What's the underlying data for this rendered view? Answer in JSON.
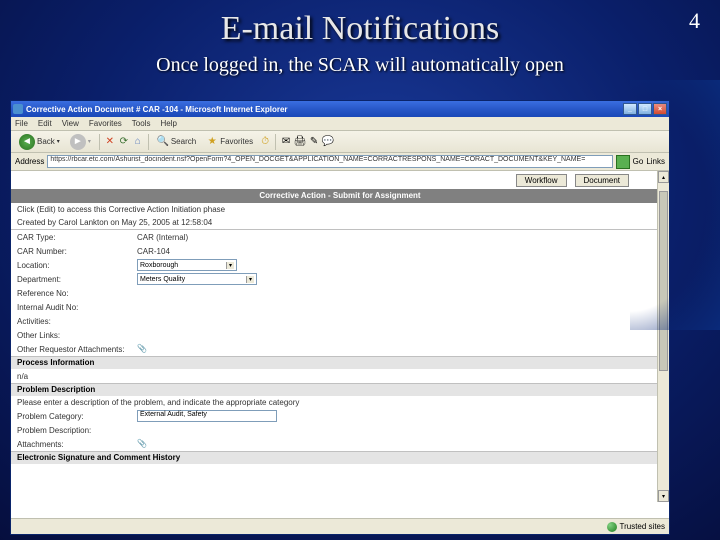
{
  "slide": {
    "title": "E-mail Notifications",
    "page_number": "4",
    "subtitle": "Once logged in, the SCAR will automatically open"
  },
  "window": {
    "title": "Corrective Action Document # CAR -104 - Microsoft Internet Explorer"
  },
  "menu": {
    "file": "File",
    "edit": "Edit",
    "view": "View",
    "favorites": "Favorites",
    "tools": "Tools",
    "help": "Help"
  },
  "toolbar": {
    "back": "Back",
    "search": "Search",
    "favorites": "Favorites"
  },
  "address": {
    "label": "Address",
    "url": "https://rbcar.etc.com/Ashurist_docindent.nsf?OpenForm?4_OPEN_DOCGET&APPLICATION_NAME=CORRACTRESPONS_NAME=CORACT_DOCUMENT&KEY_NAME=",
    "go": "Go",
    "links": "Links"
  },
  "actions": {
    "workflow": "Workflow",
    "document": "Document"
  },
  "banner": "Corrective Action - Submit for Assignment",
  "instructions": "Click (Edit) to access this Corrective Action Initiation phase",
  "created": "Created by Carol Lankton on May 25, 2005 at 12:58:04",
  "form": {
    "car_type_label": "CAR Type:",
    "car_type_value": "CAR (Internal)",
    "car_number_label": "CAR Number:",
    "car_number_value": "CAR-104",
    "location_label": "Location:",
    "location_value": "Roxborough",
    "department_label": "Department:",
    "department_value": "Meters Quality",
    "reference_label": "Reference No:",
    "internal_audit_label": "Internal Audit No:",
    "activities_label": "Activities:",
    "other_links_label": "Other Links:",
    "attachments_label": "Other Requestor Attachments:"
  },
  "sections": {
    "process": "Process Information",
    "process_na": "n/a",
    "problem": "Problem Description",
    "problem_instruction": "Please enter a description of the problem, and indicate the appropriate category",
    "category_label": "Problem Category:",
    "category_value": "External Audit, Safety",
    "description_label": "Problem Description:",
    "attachments_label": "Attachments:",
    "signature": "Electronic Signature and Comment History"
  },
  "status": {
    "zone": "Trusted sites"
  }
}
